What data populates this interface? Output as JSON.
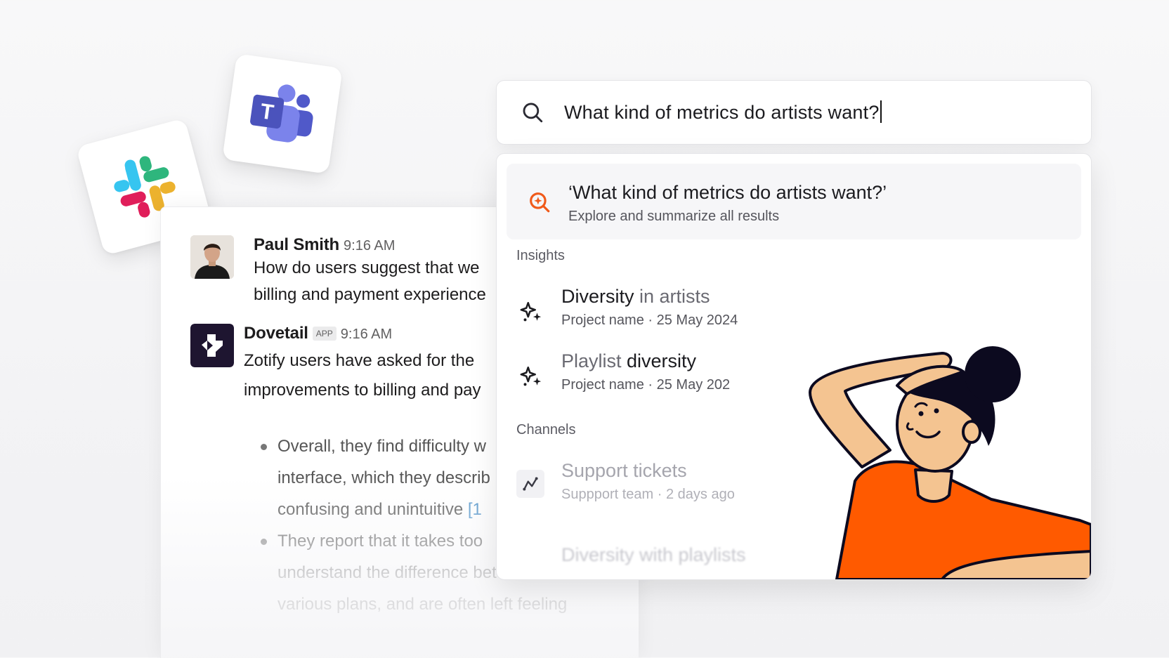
{
  "apps": {
    "slack": {
      "name": "slack-logo",
      "colors": [
        "#36C5F0",
        "#2EB67D",
        "#ECB22E",
        "#E01E5A"
      ]
    },
    "teams": {
      "name": "teams-logo",
      "colors": [
        "#5059C9",
        "#7B83EB",
        "#4B53BC"
      ],
      "letter": "T"
    }
  },
  "chat": {
    "messages": [
      {
        "author": "Paul Smith",
        "time": "9:16 AM",
        "lines": [
          "How do users suggest that we",
          "billing and payment experience"
        ]
      },
      {
        "author": "Dovetail",
        "badge": "APP",
        "time": "9:16 AM",
        "lines": [
          "Zotify users have asked for the",
          "improvements to billing and pay"
        ]
      }
    ],
    "bullets": [
      {
        "text": "Overall, they find difficulty w"
      },
      {
        "text": "interface, which they describ",
        "continuation": true
      },
      {
        "text": "confusing and unintuitive ",
        "ref": "[1",
        "continuation": true
      },
      {
        "text": "They report that it takes too"
      },
      {
        "text": "understand the difference between",
        "continuation": true
      },
      {
        "text": "various plans, and are often left feeling",
        "continuation": true
      }
    ]
  },
  "search": {
    "query": "What kind of metrics do artists want?",
    "icon": "search-icon"
  },
  "results": {
    "explore": {
      "title": "‘What kind of metrics do artists want?’",
      "subtitle": "Explore and summarize all results",
      "icon": "explore-search-icon",
      "accent": "#F05A1A"
    },
    "insights_label": "Insights",
    "insights": [
      {
        "title_bold": "Diversity",
        "title_light": " in artists",
        "subtitle": "Project name · 25 May 2024",
        "icon": "sparkle-icon"
      },
      {
        "title_light": "Playlist ",
        "title_bold": "diversity",
        "subtitle": "Project name · 25 May 202",
        "icon": "sparkle-icon"
      }
    ],
    "channels_label": "Channels",
    "channels": [
      {
        "title": "Support tickets",
        "subtitle": "Suppport team · 2 days ago",
        "icon": "channel-chart-icon"
      }
    ],
    "ghost_item": "Diversity with playlists"
  },
  "illustration": {
    "name": "person-thinking-illustration",
    "shirt_color": "#FF5A00",
    "skin_color": "#F4C491",
    "hair_color": "#0C0A1F"
  }
}
